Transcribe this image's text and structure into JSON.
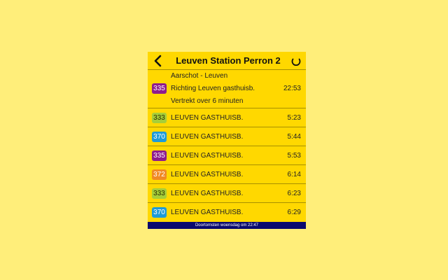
{
  "header": {
    "title": "Leuven Station Perron 2",
    "back_icon": "chevron-left-icon",
    "refresh_icon": "refresh-icon"
  },
  "first_departure": {
    "line": "335",
    "color": "#8E1C8E",
    "route": "Aarschot - Leuven",
    "direction": "Richting Leuven gasthuisb.",
    "status": "Vertrekt over 6 minuten",
    "time": "22:53"
  },
  "departures": [
    {
      "line": "333",
      "color": "#A6CE39",
      "destination": "LEUVEN GASTHUISB.",
      "time": "5:23"
    },
    {
      "line": "370",
      "color": "#1E9BD7",
      "destination": "LEUVEN GASTHUISB.",
      "time": "5:44"
    },
    {
      "line": "335",
      "color": "#8E1C8E",
      "destination": "LEUVEN GASTHUISB.",
      "time": "5:53"
    },
    {
      "line": "372",
      "color": "#F08A24",
      "destination": "LEUVEN GASTHUISB.",
      "time": "6:14"
    },
    {
      "line": "333",
      "color": "#A6CE39",
      "destination": "LEUVEN GASTHUISB.",
      "time": "6:23"
    },
    {
      "line": "370",
      "color": "#1E9BD7",
      "destination": "LEUVEN GASTHUISB.",
      "time": "6:29"
    }
  ],
  "footer": {
    "text": "Doortomsten woensdag om 22:47"
  },
  "colors": {
    "background": "#FFEE7A",
    "panel": "#FFD800",
    "footer": "#0A0A6E"
  }
}
